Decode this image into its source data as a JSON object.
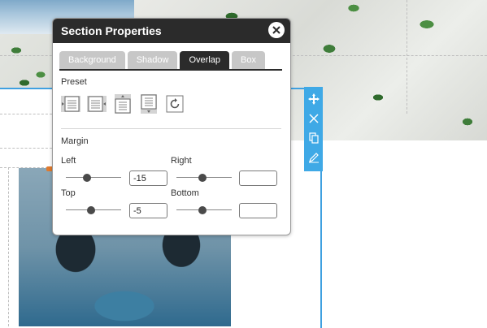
{
  "dialog": {
    "title": "Section Properties",
    "tabs": [
      {
        "label": "Background",
        "active": false
      },
      {
        "label": "Shadow",
        "active": false
      },
      {
        "label": "Overlap",
        "active": true
      },
      {
        "label": "Box",
        "active": false
      }
    ],
    "preset_label": "Preset",
    "presets": [
      {
        "icon": "overlap-left-icon"
      },
      {
        "icon": "overlap-right-icon"
      },
      {
        "icon": "overlap-top-icon"
      },
      {
        "icon": "overlap-bottom-icon"
      },
      {
        "icon": "reset-icon"
      }
    ],
    "margin_label": "Margin",
    "fields": {
      "left": {
        "label": "Left",
        "value": "-15",
        "slider_level": 0.38
      },
      "right": {
        "label": "Right",
        "value": "",
        "slider_level": 0.47
      },
      "top": {
        "label": "Top",
        "value": "-5",
        "slider_level": 0.45
      },
      "bottom": {
        "label": "Bottom",
        "value": "",
        "slider_level": 0.47
      }
    }
  },
  "side_toolbar": {
    "buttons": [
      "move-icon",
      "close-icon",
      "duplicate-icon",
      "edit-icon"
    ]
  },
  "colors": {
    "accent": "#3fa9e6",
    "dialog_header": "#2b2b2b",
    "tab_inactive": "#c7c7c7"
  }
}
